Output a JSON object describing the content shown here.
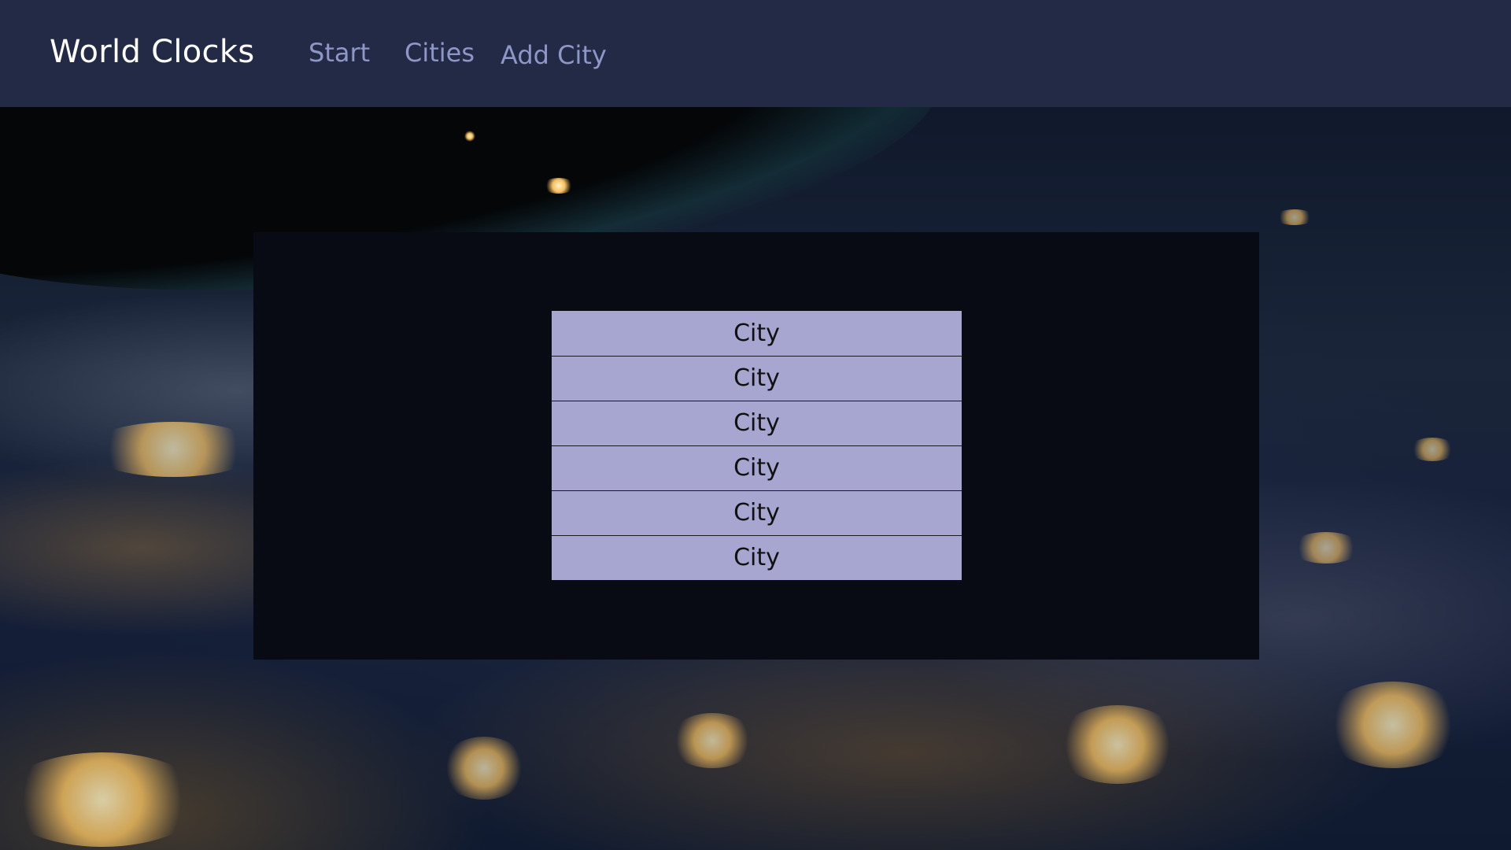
{
  "navbar": {
    "brand": "World Clocks",
    "links": [
      "Start",
      "Cities",
      "Add City"
    ]
  },
  "cities": [
    "City",
    "City",
    "City",
    "City",
    "City",
    "City"
  ],
  "colors": {
    "navbar_bg": "#222a45",
    "nav_link": "#8f97c8",
    "panel_bg": "#080b14",
    "row_bg": "#a6a6d0"
  },
  "background": "night-earth-image"
}
